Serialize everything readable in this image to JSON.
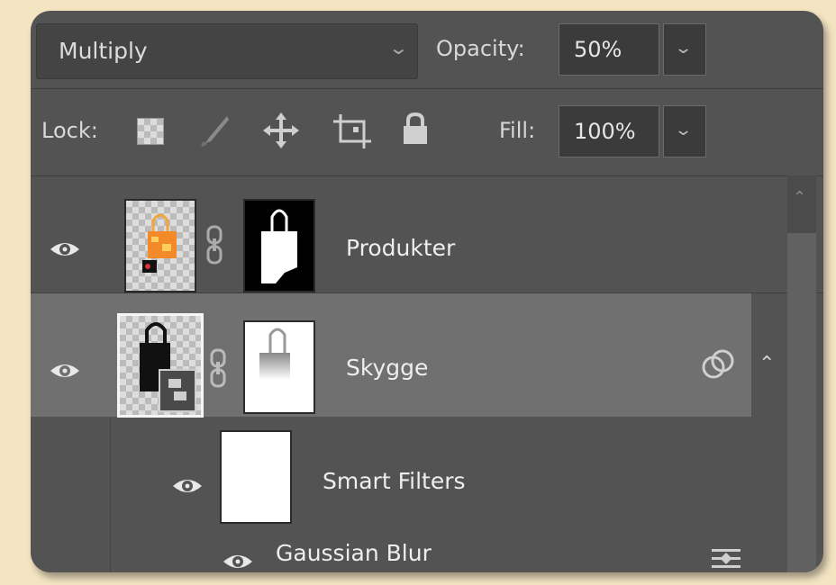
{
  "toolbar": {
    "blend_mode": "Multiply",
    "opacity_label": "Opacity:",
    "opacity_value": "50%"
  },
  "lockbar": {
    "lock_label": "Lock:",
    "fill_label": "Fill:",
    "fill_value": "100%",
    "lock_icons": [
      "lock-transparent-pixels-icon",
      "lock-image-pixels-icon",
      "lock-position-icon",
      "lock-artboard-icon",
      "lock-all-icon"
    ]
  },
  "layers": [
    {
      "name": "Produkter",
      "visible": true,
      "selected": false
    },
    {
      "name": "Skygge",
      "visible": true,
      "selected": true,
      "smart_object": true
    }
  ],
  "smart_filters": {
    "label": "Smart Filters",
    "filters": [
      {
        "name": "Gaussian Blur"
      }
    ]
  },
  "colors": {
    "panel_bg": "#535353",
    "selected_row": "#707070",
    "background": "#f3e4c2"
  }
}
